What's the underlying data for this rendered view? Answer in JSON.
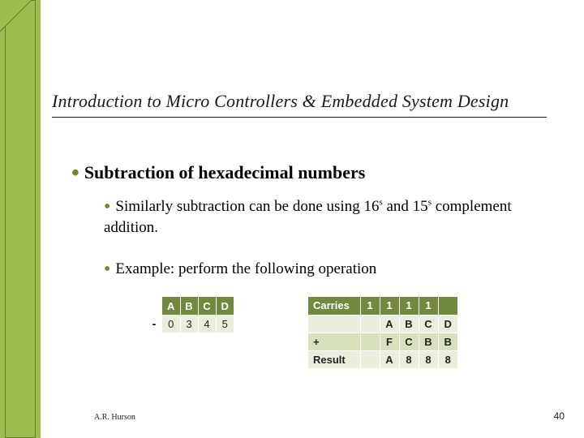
{
  "title": "Introduction to Micro Controllers & Embedded System Design",
  "bullets": {
    "main": "Subtraction of hexadecimal numbers",
    "sub1_a": "Similarly subtraction can be done using 16",
    "sub1_s1": "s",
    "sub1_b": " and 15",
    "sub1_s2": "s",
    "sub1_c": " complement addition.",
    "sub2": "Example:  perform the following operation"
  },
  "left_table": {
    "header": [
      "A",
      "B",
      "C",
      "D"
    ],
    "minus": "-",
    "row": [
      "0",
      "3",
      "4",
      "5"
    ]
  },
  "right_table": {
    "rows": [
      {
        "label": "Carries",
        "cells": [
          "1",
          "1",
          "1",
          "1",
          ""
        ]
      },
      {
        "label": "",
        "cells": [
          "",
          "A",
          "B",
          "C",
          "D"
        ]
      },
      {
        "label": "+",
        "cells": [
          "",
          "F",
          "C",
          "B",
          "B"
        ]
      },
      {
        "label": "Result",
        "cells": [
          "",
          "A",
          "8",
          "8",
          "8"
        ]
      }
    ]
  },
  "footer": {
    "author": "A.R. Hurson",
    "page": "40"
  }
}
